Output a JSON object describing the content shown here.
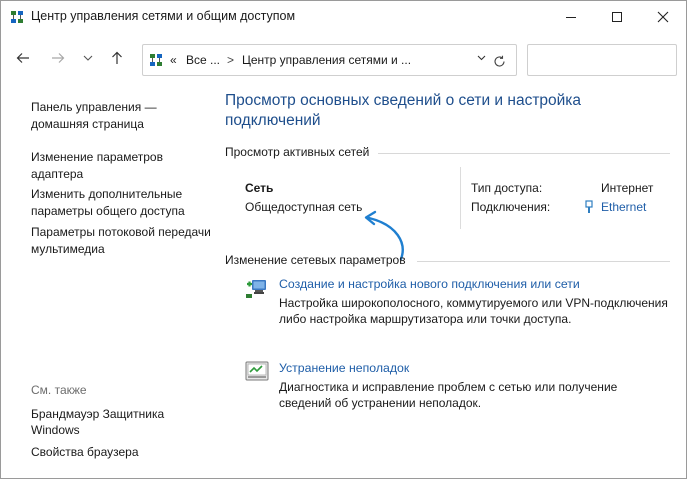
{
  "window": {
    "title": "Центр управления сетями и общим доступом"
  },
  "address": {
    "overflow": "«",
    "seg1": "Все ...",
    "sep": ">",
    "seg2": "Центр управления сетями и ...",
    "search_placeholder": ""
  },
  "sidebar": {
    "items": [
      {
        "label": "Панель управления — домашняя страница"
      },
      {
        "label": "Изменение параметров адаптера"
      },
      {
        "label": "Изменить дополнительные параметры общего доступа"
      },
      {
        "label": "Параметры потоковой передачи мультимедиа"
      }
    ],
    "see_also_title": "См. также",
    "see_also": [
      {
        "label": "Брандмауэр Защитника Windows"
      },
      {
        "label": "Свойства браузера"
      }
    ]
  },
  "main": {
    "title": "Просмотр основных сведений о сети и настройка подключений",
    "active_networks_header": "Просмотр активных сетей",
    "network": {
      "name": "Сеть",
      "category": "Общедоступная сеть",
      "access_type_label": "Тип доступа:",
      "access_type_value": "Интернет",
      "connections_label": "Подключения:",
      "connections_value": "Ethernet"
    },
    "change_settings_header": "Изменение сетевых параметров",
    "tasks": [
      {
        "link": "Создание и настройка нового подключения или сети",
        "desc": "Настройка широкополосного, коммутируемого или VPN-подключения либо настройка маршрутизатора или точки доступа."
      },
      {
        "link": "Устранение неполадок",
        "desc": "Диагностика и исправление проблем с сетью или получение сведений об устранении неполадок."
      }
    ]
  },
  "colors": {
    "title_blue": "#1e4e8c",
    "link_blue": "#1f5ea8",
    "arrow_blue": "#1f7fd0"
  },
  "icons": {
    "window": "network-center-icon",
    "back": "arrow-left-icon",
    "forward": "arrow-right-icon",
    "recent": "chevron-down-icon",
    "up": "arrow-up-icon",
    "refresh": "refresh-icon",
    "ethernet": "ethernet-icon",
    "new_connection": "new-connection-icon",
    "troubleshoot": "troubleshoot-icon",
    "annotation": "curved-arrow-icon"
  }
}
